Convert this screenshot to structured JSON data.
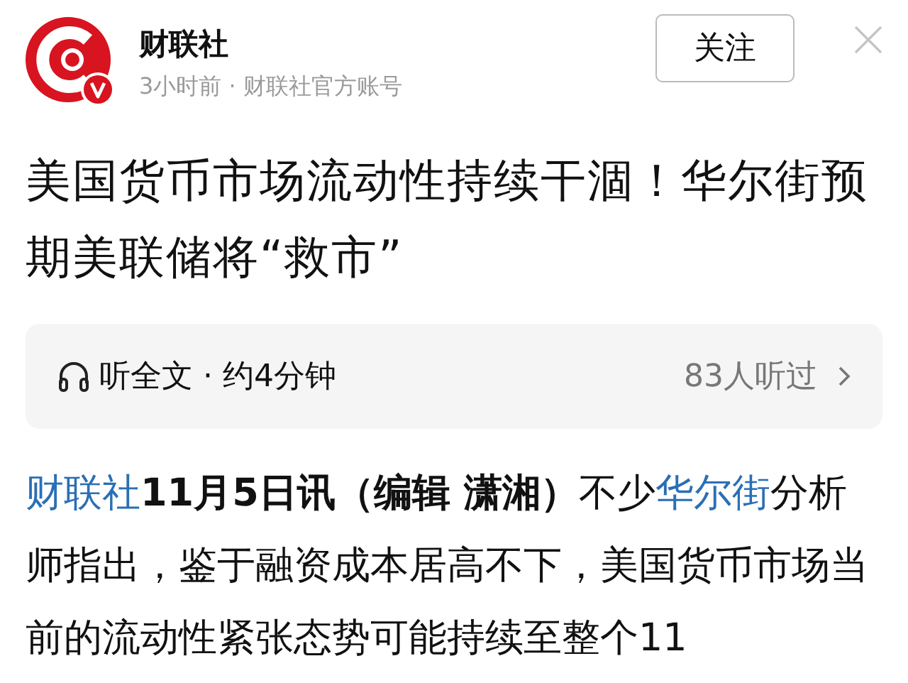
{
  "header": {
    "account_name": "财联社",
    "meta": "3小时前 · 财联社官方账号",
    "verified": true,
    "follow_button": "关注"
  },
  "title": "美国货币市场流动性持续干涸！华尔街预期美联储将“救市”",
  "audio_bar": {
    "label": "听全文 · 约4分钟",
    "listeners": "83人听过"
  },
  "paragraph": [
    {
      "kind": "link",
      "text": "财联社"
    },
    {
      "kind": "bold",
      "text": "11月5日讯（编辑 潇湘）"
    },
    {
      "kind": "plain",
      "text": "不少"
    },
    {
      "kind": "link",
      "text": "华尔街"
    },
    {
      "kind": "plain",
      "text": "分析师指出，鉴于融资成本居高不下，美国货币市场当前的流动性紧张态势可能持续至整个11"
    }
  ]
}
